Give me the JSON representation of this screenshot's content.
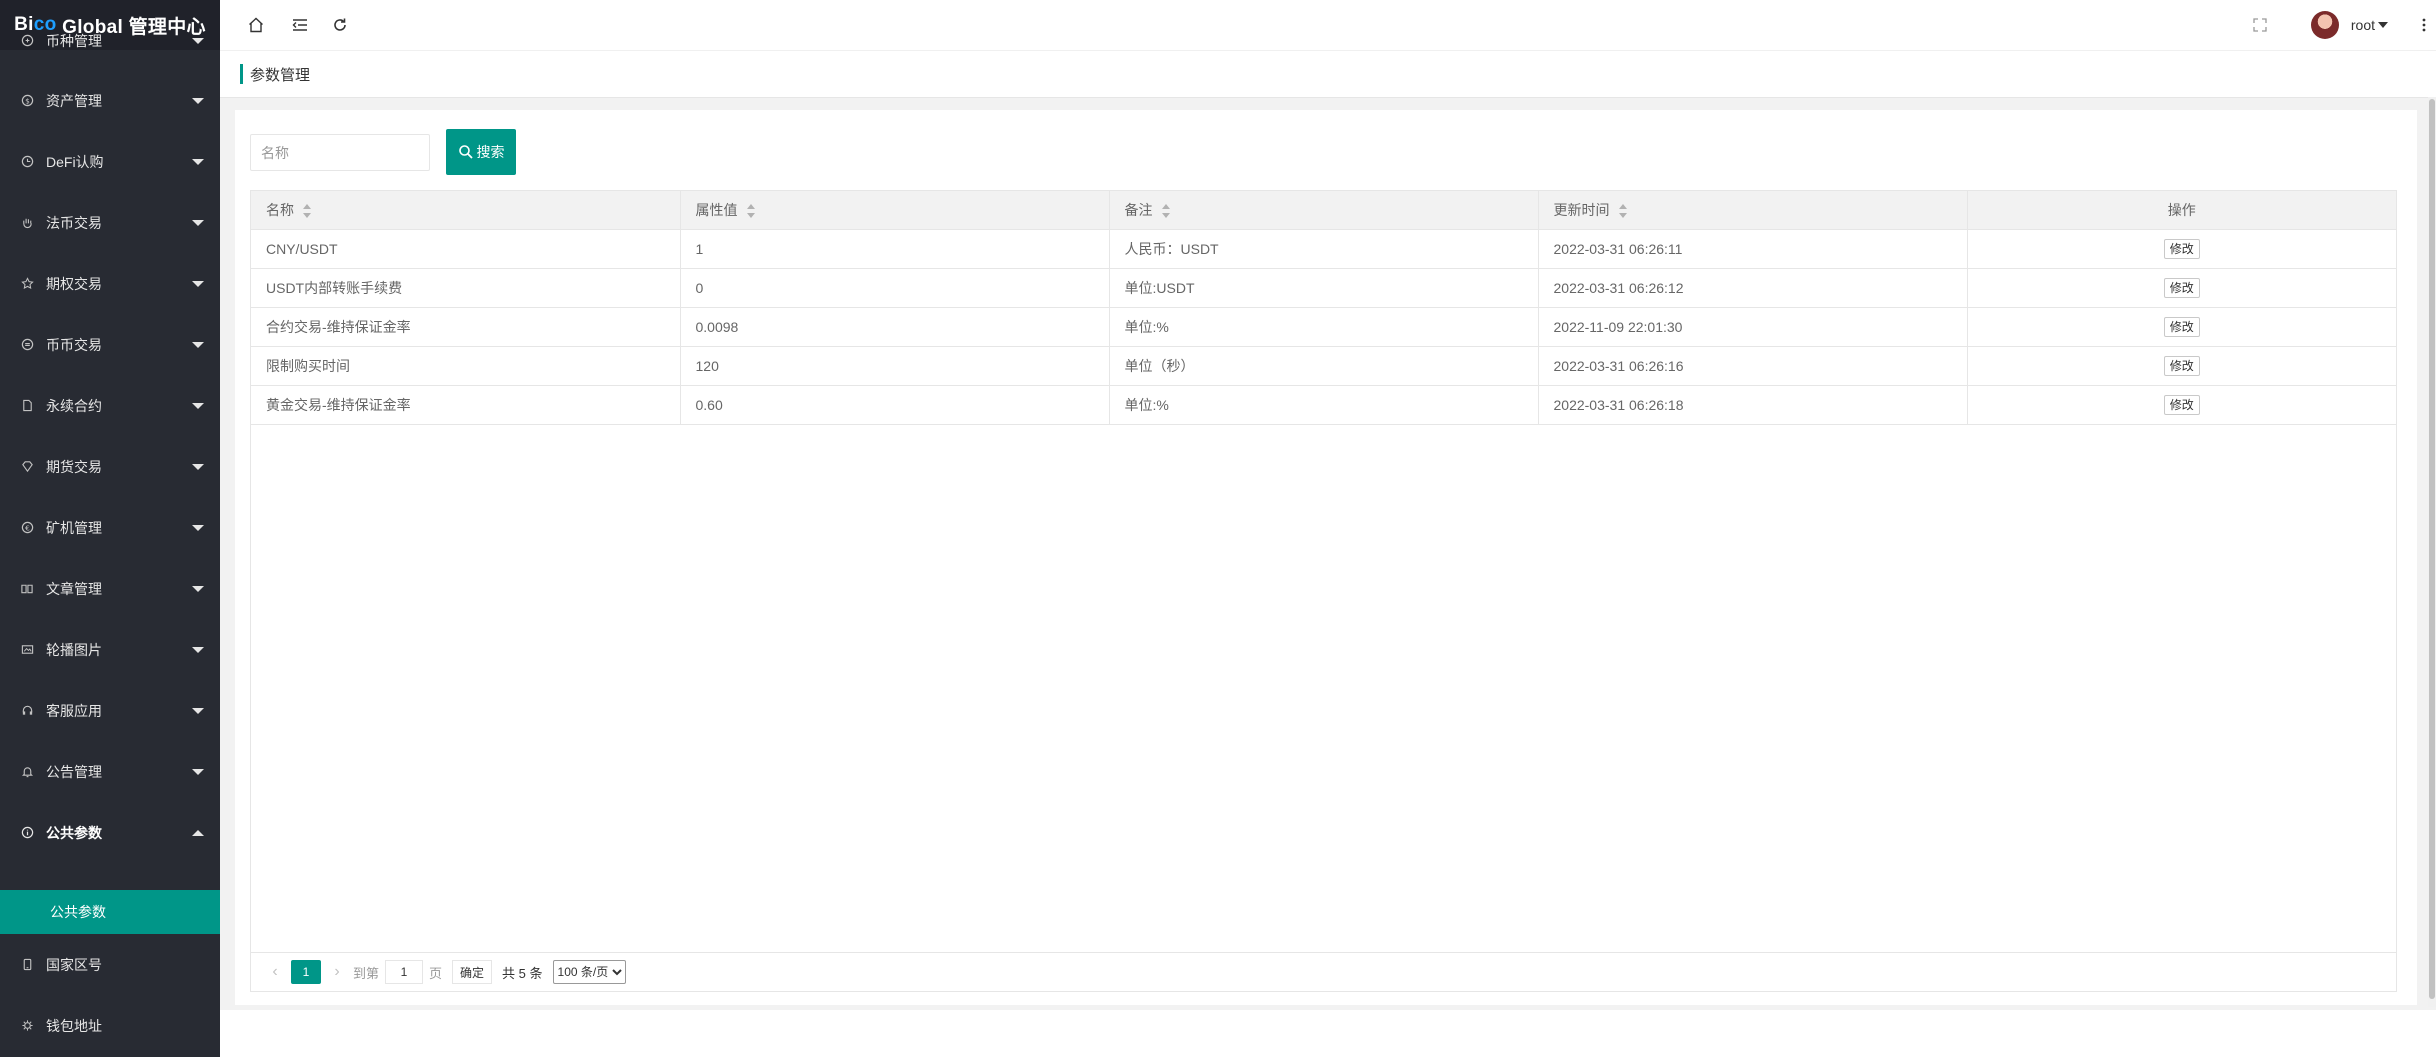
{
  "app": {
    "logo_part1": "Bi",
    "logo_accent": "co",
    "logo_part2": " Global 管理中心"
  },
  "sidebar": {
    "items": [
      {
        "label": "币种管理",
        "icon": "coin-icon"
      },
      {
        "label": "资产管理",
        "icon": "dollar-icon"
      },
      {
        "label": "DeFi认购",
        "icon": "clock-icon"
      },
      {
        "label": "法币交易",
        "icon": "hand-icon"
      },
      {
        "label": "期权交易",
        "icon": "star-icon"
      },
      {
        "label": "币币交易",
        "icon": "exchange-icon"
      },
      {
        "label": "永续合约",
        "icon": "document-icon"
      },
      {
        "label": "期货交易",
        "icon": "diamond-icon"
      },
      {
        "label": "矿机管理",
        "icon": "miner-icon"
      },
      {
        "label": "文章管理",
        "icon": "book-icon"
      },
      {
        "label": "轮播图片",
        "icon": "image-icon"
      },
      {
        "label": "客服应用",
        "icon": "headset-icon"
      },
      {
        "label": "公告管理",
        "icon": "bell-icon"
      },
      {
        "label": "公共参数",
        "icon": "info-icon",
        "open": true
      },
      {
        "label": "国家区号",
        "icon": "phone-icon"
      },
      {
        "label": "钱包地址",
        "icon": "wallet-icon"
      }
    ],
    "active_sub": "公共参数"
  },
  "header": {
    "username": "root"
  },
  "breadcrumb": {
    "title": "参数管理"
  },
  "search": {
    "placeholder": "名称",
    "button_label": "搜索"
  },
  "table": {
    "columns": [
      "名称",
      "属性值",
      "备注",
      "更新时间",
      "操作"
    ],
    "rows": [
      {
        "name": "CNY/USDT",
        "value": "1",
        "remark": "人民币：USDT",
        "updated": "2022-03-31 06:26:11",
        "action": "修改"
      },
      {
        "name": "USDT内部转账手续费",
        "value": "0",
        "remark": "单位:USDT",
        "updated": "2022-03-31 06:26:12",
        "action": "修改"
      },
      {
        "name": "合约交易-维持保证金率",
        "value": "0.0098",
        "remark": "单位:%",
        "updated": "2022-11-09 22:01:30",
        "action": "修改"
      },
      {
        "name": "限制购买时间",
        "value": "120",
        "remark": "单位（秒）",
        "updated": "2022-03-31 06:26:16",
        "action": "修改"
      },
      {
        "name": "黄金交易-维持保证金率",
        "value": "0.60",
        "remark": "单位:%",
        "updated": "2022-03-31 06:26:18",
        "action": "修改"
      }
    ]
  },
  "pagination": {
    "current_page": "1",
    "goto_label": "到第",
    "goto_value": "1",
    "page_unit": "页",
    "confirm_label": "确定",
    "total_text": "共 5 条",
    "page_size": "100 条/页"
  },
  "colors": {
    "accent": "#009688",
    "sidebar_bg": "#282b33",
    "logo_blue": "#1e9fff"
  }
}
